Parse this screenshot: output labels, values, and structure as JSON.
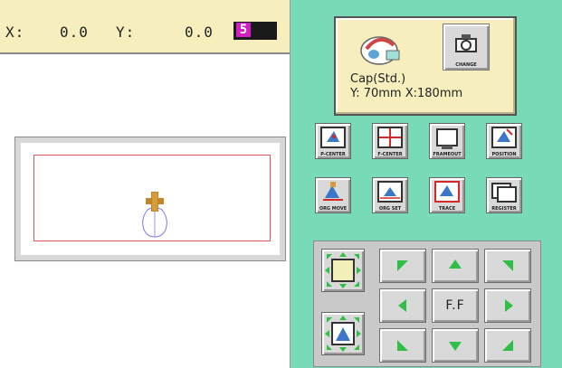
{
  "coords": {
    "x_label": "X:",
    "x_value": "0.0",
    "y_label": "Y:",
    "y_value": "0.0",
    "needle_number": "5"
  },
  "frame": {
    "name": "Cap(Std.)",
    "size": "Y: 70mm  X:180mm",
    "change_label": "CHANGE"
  },
  "functions": [
    {
      "label": "P-CENTER"
    },
    {
      "label": "F-CENTER"
    },
    {
      "label": "FRAMEOUT"
    },
    {
      "label": "POSITION"
    },
    {
      "label": "ORG MOVE"
    },
    {
      "label": "ORG SET"
    },
    {
      "label": "TRACE"
    },
    {
      "label": "REGISTER"
    }
  ],
  "move_pad": {
    "center_label": "F.F"
  },
  "colors": {
    "accent": "#78dab6",
    "info_bg": "#f6efbd",
    "needle_badge": "#d21ec8",
    "arrow_green": "#2fbf47",
    "hoop_border": "#e05656"
  }
}
